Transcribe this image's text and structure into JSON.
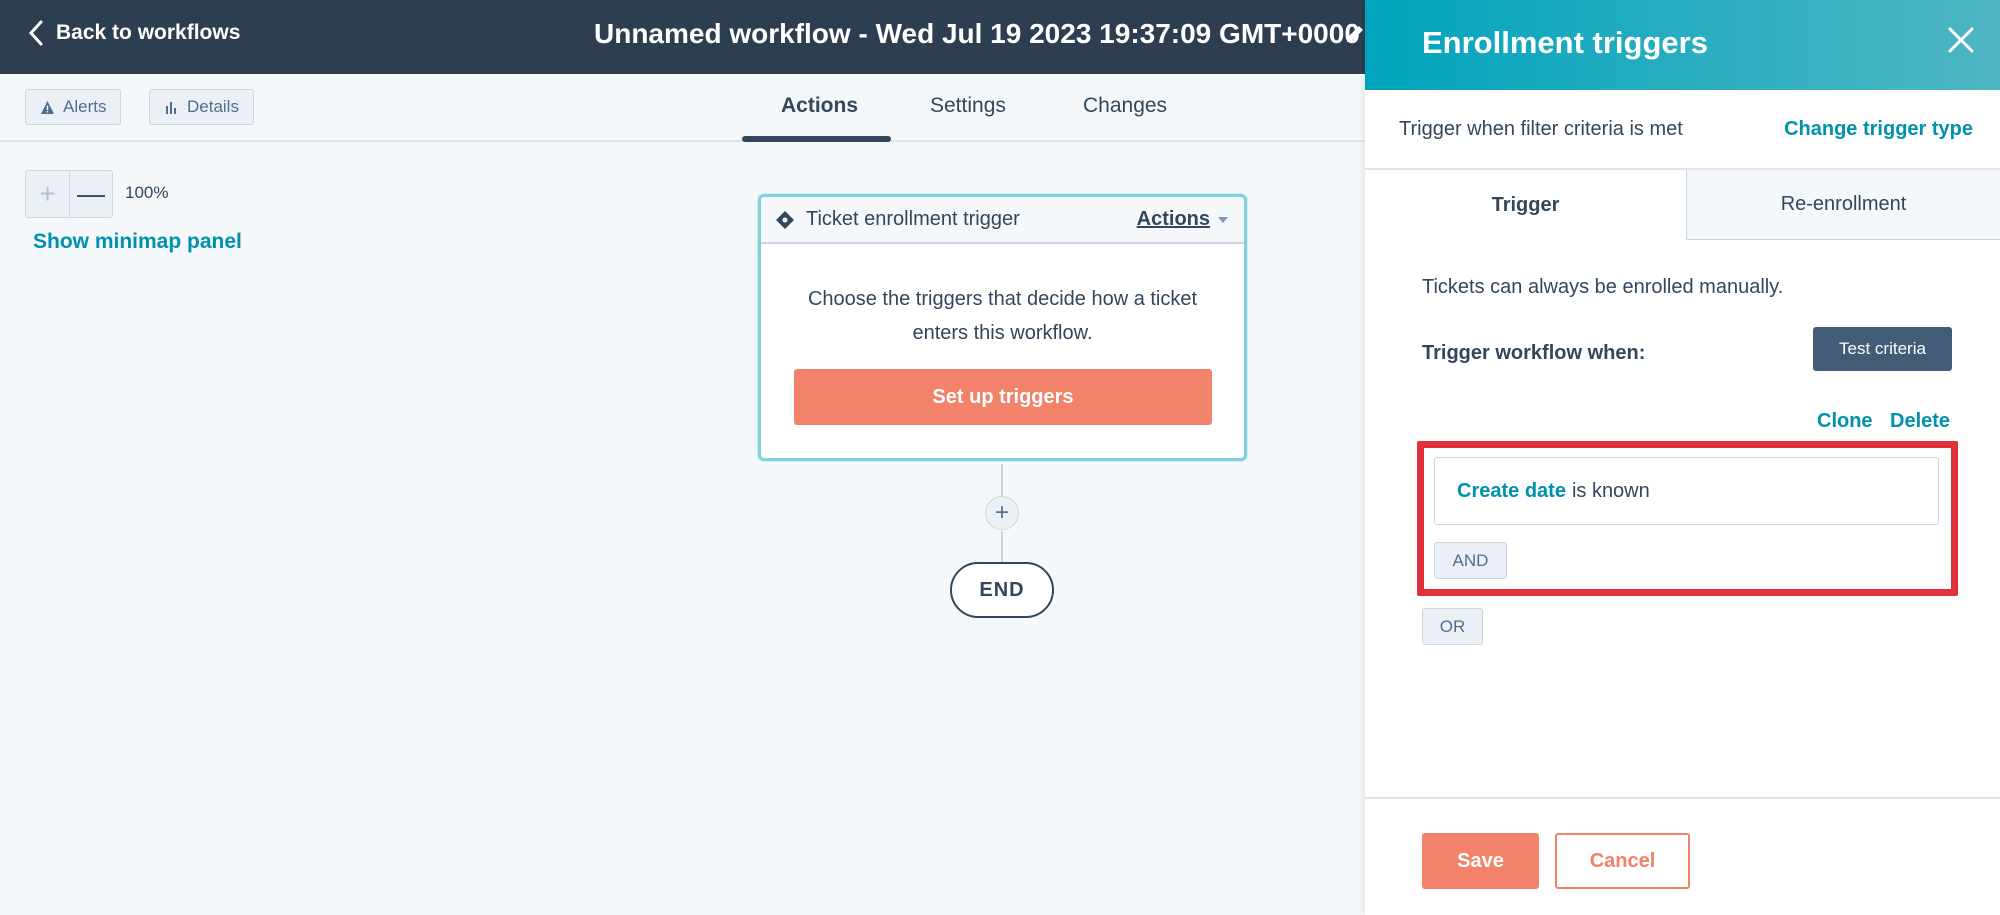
{
  "topbar": {
    "back_label": "Back to workflows",
    "workflow_title": "Unnamed workflow - Wed Jul 19 2023 19:37:09 GMT+0000"
  },
  "subbar": {
    "alerts_label": "Alerts",
    "details_label": "Details",
    "tabs": [
      {
        "label": "Actions",
        "active": true
      },
      {
        "label": "Settings",
        "active": false
      },
      {
        "label": "Changes",
        "active": false
      }
    ]
  },
  "canvas": {
    "zoom_plus": "+",
    "zoom_minus": "—",
    "zoom_level": "100%",
    "minimap_link": "Show minimap panel",
    "trigger_card": {
      "title": "Ticket enrollment trigger",
      "actions_label": "Actions",
      "description": "Choose the triggers that decide how a ticket enters this workflow.",
      "setup_button": "Set up triggers"
    },
    "add_action": "+",
    "end_label": "END"
  },
  "panel": {
    "title": "Enrollment triggers",
    "trigger_type_text": "Trigger when filter criteria is met",
    "change_trigger_type": "Change trigger type",
    "tabs": [
      {
        "label": "Trigger",
        "active": true
      },
      {
        "label": "Re-enrollment",
        "active": false
      }
    ],
    "manual_note": "Tickets can always be enrolled manually.",
    "trigger_when": "Trigger workflow when:",
    "test_criteria": "Test criteria",
    "clone": "Clone",
    "delete": "Delete",
    "filter": {
      "property": "Create date",
      "operator": "is known"
    },
    "and_label": "AND",
    "or_label": "OR",
    "save": "Save",
    "cancel": "Cancel"
  },
  "colors": {
    "topbar": "#2d3e50",
    "accent": "#0091ae",
    "primary_button": "#f2826a",
    "panel_header": "#00a4bd",
    "highlight": "#e0323b"
  }
}
